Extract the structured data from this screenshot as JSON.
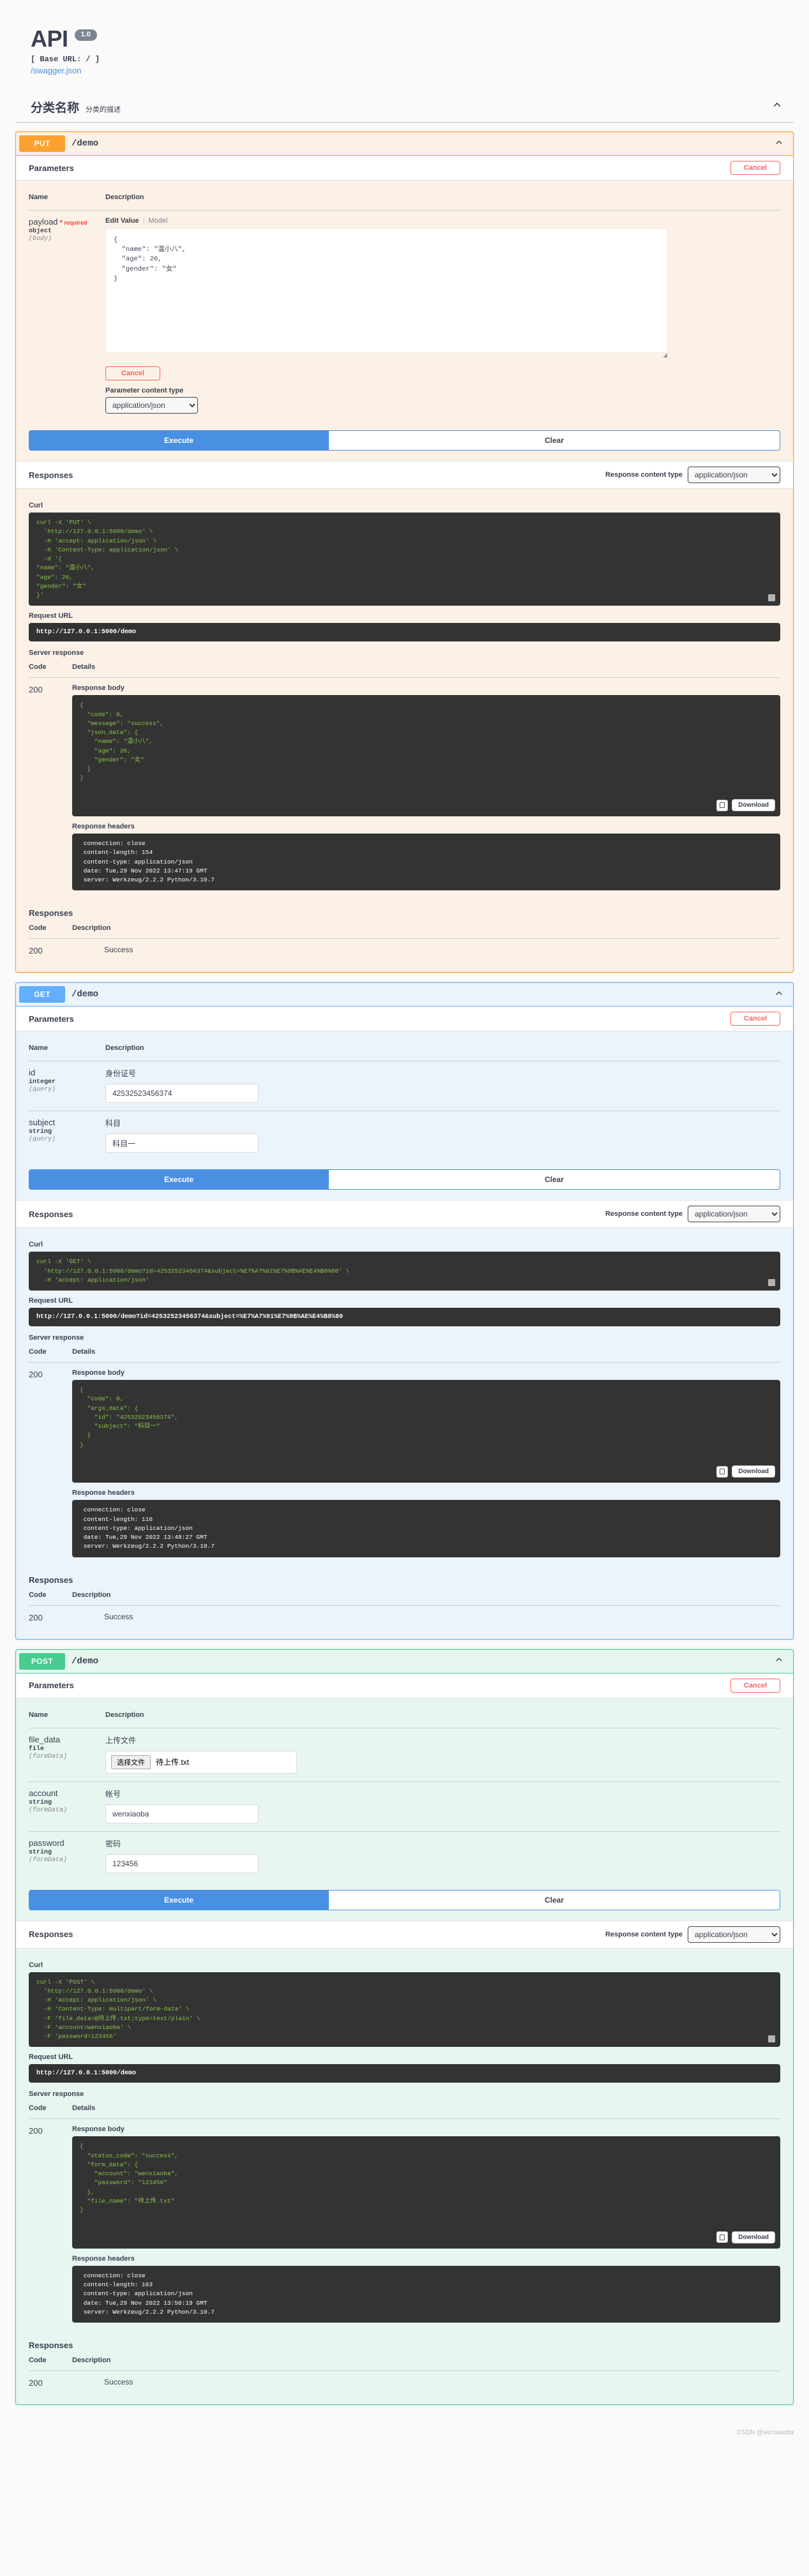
{
  "header": {
    "title": "API",
    "version": "1.0",
    "base_url": "[ Base URL: / ]",
    "spec_link": "/swagger.json"
  },
  "tag": {
    "name": "分类名称",
    "description": "分类的描述",
    "collapse_icon": "chevron-up-icon"
  },
  "labels": {
    "parameters": "Parameters",
    "cancel": "Cancel",
    "name": "Name",
    "description": "Description",
    "execute": "Execute",
    "clear": "Clear",
    "responses": "Responses",
    "response_content_type": "Response content type",
    "parameter_content_type": "Parameter content type",
    "curl": "Curl",
    "request_url": "Request URL",
    "server_response": "Server response",
    "code": "Code",
    "details": "Details",
    "response_body": "Response body",
    "response_headers": "Response headers",
    "download": "Download",
    "edit_value": "Edit Value",
    "model": "Model",
    "success": "Success",
    "code_200": "200",
    "content_type_value": "application/json"
  },
  "operations": [
    {
      "id": "put-demo",
      "method": "PUT",
      "path": "/demo",
      "color": "#fca130",
      "parameters": [
        {
          "name": "payload",
          "required": true,
          "required_label": "required",
          "type": "object",
          "in": "(body)",
          "edit_value": "Edit Value",
          "model": "Model",
          "body_value": "{\n  \"name\": \"温小八\",\n  \"age\": 26,\n  \"gender\": \"女\"\n}"
        }
      ],
      "parameter_content_type": "application/json",
      "response_content_type": "application/json",
      "curl": "curl -X 'PUT' \\\n  'http://127.0.0.1:5000/demo' \\\n  -H 'accept: application/json' \\\n  -H 'Content-Type: application/json' \\\n  -d '{\n\"name\": \"温小八\",\n\"age\": 26,\n\"gender\": \"女\"\n}'",
      "request_url": "http://127.0.0.1:5000/demo",
      "server_response": {
        "code": "200",
        "response_body": "{\n  \"code\": 0,\n  \"message\": \"success\",\n  \"json_data\": {\n    \"name\": \"温小八\",\n    \"age\": 26,\n    \"gender\": \"女\"\n  }\n}",
        "response_headers": " connection: close \n content-length: 154 \n content-type: application/json \n date: Tue,29 Nov 2022 13:47:19 GMT \n server: Werkzeug/2.2.2 Python/3.10.7 "
      },
      "responses_table": {
        "code": "200",
        "description": "Success"
      }
    },
    {
      "id": "get-demo",
      "method": "GET",
      "path": "/demo",
      "color": "#61affe",
      "parameters": [
        {
          "name": "id",
          "required": false,
          "type": "integer",
          "in": "(query)",
          "description": "身份证号",
          "value": "42532523456374"
        },
        {
          "name": "subject",
          "required": false,
          "type": "string",
          "in": "(query)",
          "description": "科目",
          "value": "科目一"
        }
      ],
      "response_content_type": "application/json",
      "curl": "curl -X 'GET' \\\n  'http://127.0.0.1:5000/demo?id=42532523456374&subject=%E7%A7%91%E7%9B%AE%E4%B8%80' \\\n  -H 'accept: application/json'",
      "request_url": "http://127.0.0.1:5000/demo?id=42532523456374&subject=%E7%A7%91%E7%9B%AE%E4%B8%80",
      "server_response": {
        "code": "200",
        "response_body": "{\n  \"code\": 0,\n  \"args_data\": {\n    \"id\": \"42532523456374\",\n    \"subject\": \"科目一\"\n  }\n}",
        "response_headers": " connection: close \n content-length: 116 \n content-type: application/json \n date: Tue,29 Nov 2022 13:48:27 GMT \n server: Werkzeug/2.2.2 Python/3.10.7 "
      },
      "responses_table": {
        "code": "200",
        "description": "Success"
      }
    },
    {
      "id": "post-demo",
      "method": "POST",
      "path": "/demo",
      "color": "#49cc90",
      "parameters": [
        {
          "name": "file_data",
          "required": false,
          "type": "file",
          "in": "(formData)",
          "description": "上传文件",
          "file_button": "选择文件",
          "file_name": "待上传.txt"
        },
        {
          "name": "account",
          "required": false,
          "type": "string",
          "in": "(formData)",
          "description": "帐号",
          "value": "wenxiaoba"
        },
        {
          "name": "password",
          "required": false,
          "type": "string",
          "in": "(formData)",
          "description": "密码",
          "value": "123456"
        }
      ],
      "response_content_type": "application/json",
      "curl": "curl -X 'POST' \\\n  'http://127.0.0.1:5000/demo' \\\n  -H 'accept: application/json' \\\n  -H 'Content-Type: multipart/form-data' \\\n  -F 'file_data=@待上传.txt;type=text/plain' \\\n  -F 'account=wenxiaoba' \\\n  -F 'password=123456'",
      "request_url": "http://127.0.0.1:5000/demo",
      "server_response": {
        "code": "200",
        "response_body": "{\n  \"status_code\": \"success\",\n  \"form_data\": {\n    \"account\": \"wenxiaoba\",\n    \"password\": \"123456\"\n  },\n  \"file_name\": \"待上传.txt\"\n}",
        "response_headers": " connection: close \n content-length: 163 \n content-type: application/json \n date: Tue,29 Nov 2022 13:50:19 GMT \n server: Werkzeug/2.2.2 Python/3.10.7 "
      },
      "responses_table": {
        "code": "200",
        "description": "Success"
      }
    }
  ],
  "watermark": "CSDN @wenxiaoba"
}
